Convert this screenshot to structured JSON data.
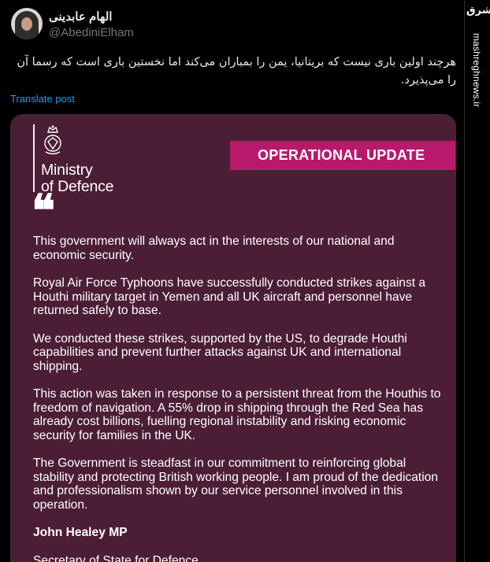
{
  "author": {
    "display_name": "الهام عابدینی",
    "handle": "@AbediniElham"
  },
  "tweet": {
    "text": "هرچند اولین باری نیست که بریتانیا، یمن را بمباران می‌کند اما نخستین باری است که رسما آن را می‌پذیرد.",
    "translate_label": "Translate post"
  },
  "card": {
    "org_line1": "Ministry",
    "org_line2": "of Defence",
    "banner": "OPERATIONAL UPDATE",
    "quote_mark": "❝",
    "paragraphs": [
      "This government will always act in the interests of our national and economic security.",
      "Royal Air Force Typhoons have successfully conducted strikes against a Houthi military target in Yemen and all UK aircraft and personnel have returned safely to base.",
      "We conducted these strikes, supported by the US, to degrade Houthi capabilities and prevent further attacks against UK and international shipping.",
      "This action was taken in response to a persistent threat from the Houthis to freedom of navigation. A 55% drop in shipping through the Red Sea has already cost billions, fuelling regional instability and risking economic security for families in the UK.",
      "The Government is steadfast in our commitment to reinforcing global stability and protecting British working people. I am proud of the dedication and professionalism shown by our service personnel involved in this operation."
    ],
    "signer": "John Healey MP",
    "signer_title": "Secretary of State for Defence"
  },
  "watermark": {
    "logo_text": "مشرق",
    "site": "mashreghnews.ir"
  },
  "colors": {
    "card_bg": "#4b1e35",
    "banner_bg": "#b8196b",
    "link": "#1d9bf0"
  }
}
